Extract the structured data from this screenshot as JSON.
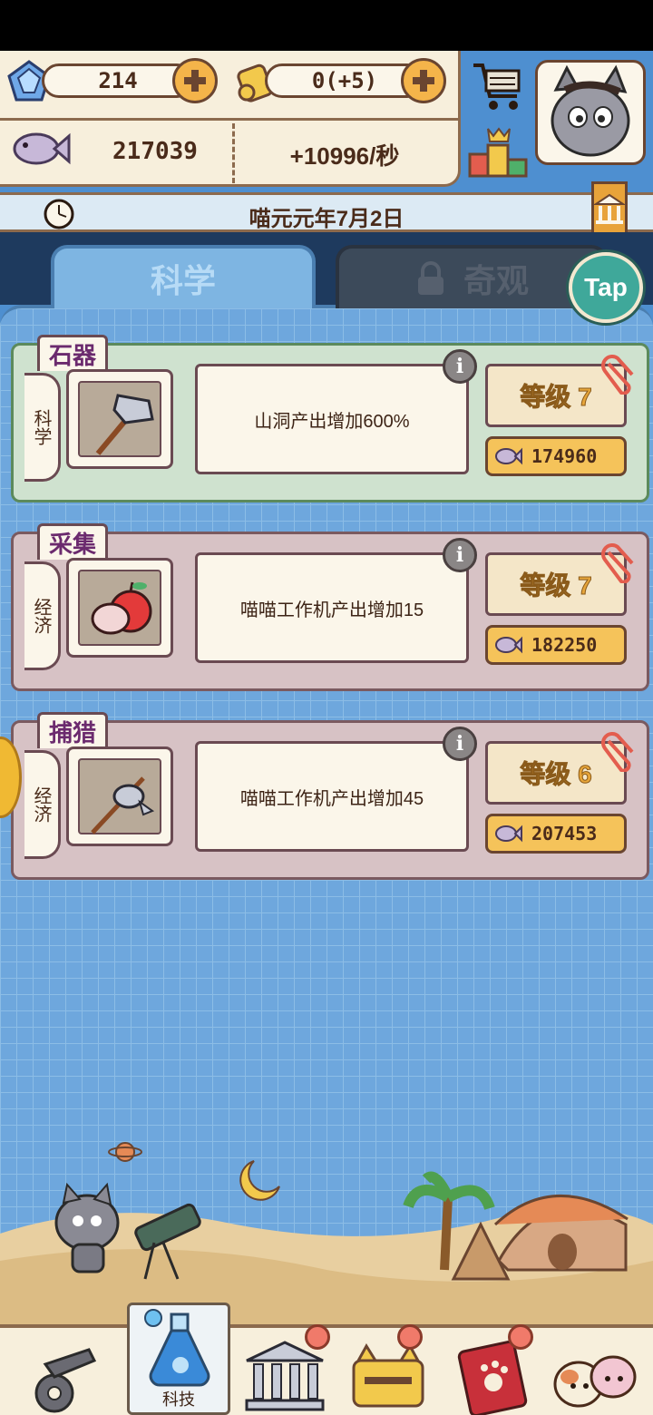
{
  "resources": {
    "gems": "214",
    "scrolls": "0(+5)",
    "fish_total": "217039",
    "fish_rate": "+10996/秒"
  },
  "date": "喵元元年7月2日",
  "tabs": {
    "science": "科学",
    "wonders": "奇观",
    "wonders_locked": true
  },
  "tap_button": "Tap",
  "cards": [
    {
      "title": "石器",
      "category": "科学",
      "description": "山洞产出增加600%",
      "level": "等级 7",
      "cost": "174960",
      "theme": "#cfe2cf",
      "border": "#5c8a5c",
      "icon": "stone-hammer-icon"
    },
    {
      "title": "采集",
      "category": "经济",
      "description": "喵喵工作机产出增加15",
      "level": "等级 7",
      "cost": "182250",
      "theme": "#d7c2c5",
      "border": "#7a5a60",
      "icon": "apple-icon"
    },
    {
      "title": "捕猎",
      "category": "经济",
      "description": "喵喵工作机产出增加45",
      "level": "等级 6",
      "cost": "207453",
      "theme": "#d7c2c5",
      "border": "#7a5a60",
      "icon": "spear-fish-icon"
    }
  ],
  "bottom_nav": {
    "active_label": "科技",
    "items": [
      "cart-wheel-icon",
      "potion-flask-icon",
      "museum-icon",
      "cat-box-icon",
      "paw-book-icon",
      "cat-family-icon"
    ]
  }
}
